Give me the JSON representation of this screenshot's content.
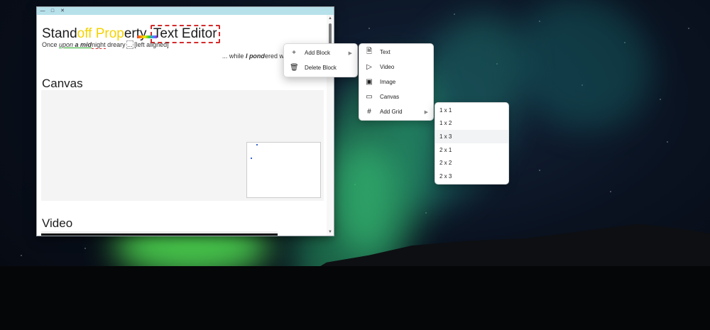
{
  "window": {
    "controls": [
      "—",
      "□",
      "✕"
    ]
  },
  "document": {
    "title_parts": [
      "Stand",
      "off Prop",
      "erty ",
      "Text Editor"
    ],
    "line1": {
      "p1": "Once ",
      "p2": "upon ",
      "p3": "a mid",
      "p4": "night",
      "p5": " dreary ",
      "p6": "...",
      "p7": " [left aligned]"
    },
    "line2": {
      "p1": "... while ",
      "p2": "I pond",
      "p3": "ered weak and wear"
    },
    "sections": {
      "canvas": "Canvas",
      "video": "Video"
    }
  },
  "context_menu": {
    "items": [
      {
        "label": "Add Block",
        "icon": "plus-icon",
        "has_submenu": true
      },
      {
        "label": "Delete Block",
        "icon": "trash-icon",
        "has_submenu": false
      }
    ]
  },
  "add_block_menu": {
    "items": [
      {
        "label": "Text",
        "icon": "document-icon"
      },
      {
        "label": "Video",
        "icon": "video-icon"
      },
      {
        "label": "Image",
        "icon": "image-icon"
      },
      {
        "label": "Canvas",
        "icon": "canvas-icon"
      },
      {
        "label": "Add Grid",
        "icon": "hash-icon",
        "has_submenu": true
      }
    ]
  },
  "grid_menu": {
    "items": [
      "1 x 1",
      "1 x 2",
      "1 x 3",
      "2 x 1",
      "2 x 2",
      "2 x 3"
    ],
    "highlighted": "1 x 3"
  },
  "colors": {
    "titlebar": "#b7e1ea",
    "title_highlight": "#f5d300",
    "squiggle": "#d42b2b",
    "menu_hover": "#f1f3f5"
  }
}
